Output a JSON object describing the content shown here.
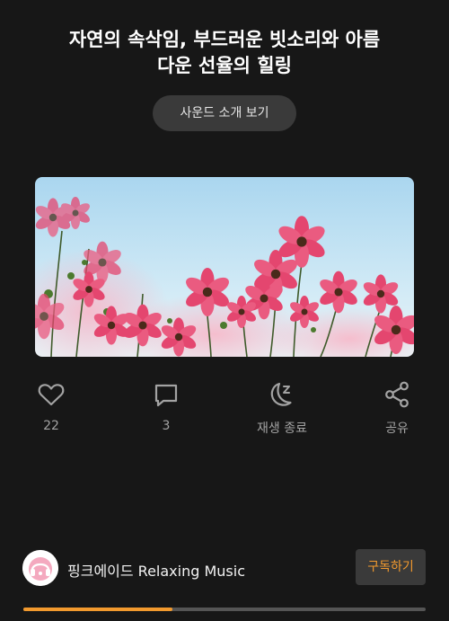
{
  "header": {
    "title_line1": "자연의 속삭임, 부드러운 빗소리와 아름",
    "title_line2": "다운 선율의 힐링",
    "intro_button": "사운드 소개 보기"
  },
  "actions": {
    "like": {
      "icon": "heart-icon",
      "label": "22"
    },
    "comment": {
      "icon": "comment-icon",
      "label": "3"
    },
    "sleep_timer": {
      "icon": "moon-sleep-icon",
      "label": "재생 종료"
    },
    "share": {
      "icon": "share-icon",
      "label": "공유"
    }
  },
  "channel": {
    "name": "핑크에이드 Relaxing Music",
    "subscribe_button": "구독하기"
  },
  "player": {
    "progress_percent": 37
  },
  "colors": {
    "background": "#171717",
    "accent": "#f29a2e",
    "button_bg": "#3a3a3a",
    "muted_text": "#a3a3a3"
  }
}
